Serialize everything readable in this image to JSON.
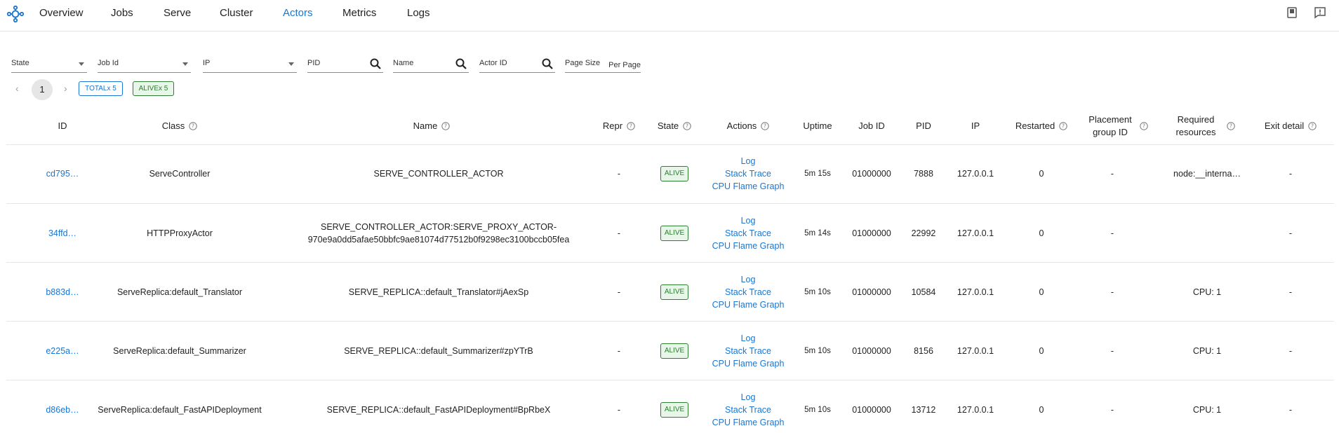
{
  "nav": {
    "items": [
      {
        "label": "Overview",
        "active": false
      },
      {
        "label": "Jobs",
        "active": false
      },
      {
        "label": "Serve",
        "active": false
      },
      {
        "label": "Cluster",
        "active": false
      },
      {
        "label": "Actors",
        "active": true
      },
      {
        "label": "Metrics",
        "active": false
      },
      {
        "label": "Logs",
        "active": false
      }
    ],
    "accent_color": "#1976d2"
  },
  "filters": {
    "state_label": "State",
    "job_id_label": "Job Id",
    "ip_label": "IP",
    "pid_label": "PID",
    "name_label": "Name",
    "actor_id_label": "Actor ID",
    "page_size_label": "Page Size",
    "page_size_value": "Per Page"
  },
  "pagination": {
    "current_page": "1",
    "total_chip": "TOTALx 5",
    "alive_chip": "ALIVEx 5"
  },
  "table": {
    "headers": {
      "id": "ID",
      "class": "Class",
      "name": "Name",
      "repr": "Repr",
      "state": "State",
      "actions": "Actions",
      "uptime": "Uptime",
      "job_id": "Job ID",
      "pid": "PID",
      "ip": "IP",
      "restarted": "Restarted",
      "placement_group_id": "Placement group ID",
      "required_resources": "Required resources",
      "exit_detail": "Exit detail"
    },
    "rows": [
      {
        "id": "cd795…",
        "class": "ServeController",
        "name": "SERVE_CONTROLLER_ACTOR",
        "repr": "-",
        "state": "ALIVE",
        "action_log": "Log",
        "action_stack": "Stack Trace",
        "action_flame": "CPU Flame Graph",
        "uptime": "5m 15s",
        "job_id": "01000000",
        "pid": "7888",
        "ip": "127.0.0.1",
        "restarted": "0",
        "placement_group_id": "-",
        "required_resources": "node:__interna…",
        "exit_detail": "-"
      },
      {
        "id": "34ffd…",
        "class": "HTTPProxyActor",
        "name": "SERVE_CONTROLLER_ACTOR:SERVE_PROXY_ACTOR-970e9a0dd5afae50bbfc9ae81074d77512b0f9298ec3100bccb05fea",
        "repr": "-",
        "state": "ALIVE",
        "action_log": "Log",
        "action_stack": "Stack Trace",
        "action_flame": "CPU Flame Graph",
        "uptime": "5m 14s",
        "job_id": "01000000",
        "pid": "22992",
        "ip": "127.0.0.1",
        "restarted": "0",
        "placement_group_id": "-",
        "required_resources": "",
        "exit_detail": "-"
      },
      {
        "id": "b883d…",
        "class": "ServeReplica:default_Translator",
        "name": "SERVE_REPLICA::default_Translator#jAexSp",
        "repr": "-",
        "state": "ALIVE",
        "action_log": "Log",
        "action_stack": "Stack Trace",
        "action_flame": "CPU Flame Graph",
        "uptime": "5m 10s",
        "job_id": "01000000",
        "pid": "10584",
        "ip": "127.0.0.1",
        "restarted": "0",
        "placement_group_id": "-",
        "required_resources": "CPU: 1",
        "exit_detail": "-"
      },
      {
        "id": "e225a…",
        "class": "ServeReplica:default_Summarizer",
        "name": "SERVE_REPLICA::default_Summarizer#zpYTrB",
        "repr": "-",
        "state": "ALIVE",
        "action_log": "Log",
        "action_stack": "Stack Trace",
        "action_flame": "CPU Flame Graph",
        "uptime": "5m 10s",
        "job_id": "01000000",
        "pid": "8156",
        "ip": "127.0.0.1",
        "restarted": "0",
        "placement_group_id": "-",
        "required_resources": "CPU: 1",
        "exit_detail": "-"
      },
      {
        "id": "d86eb…",
        "class": "ServeReplica:default_FastAPIDeployment",
        "name": "SERVE_REPLICA::default_FastAPIDeployment#BpRbeX",
        "repr": "-",
        "state": "ALIVE",
        "action_log": "Log",
        "action_stack": "Stack Trace",
        "action_flame": "CPU Flame Graph",
        "uptime": "5m 10s",
        "job_id": "01000000",
        "pid": "13712",
        "ip": "127.0.0.1",
        "restarted": "0",
        "placement_group_id": "-",
        "required_resources": "CPU: 1",
        "exit_detail": "-"
      }
    ]
  },
  "colors": {
    "link": "#1976d2",
    "alive_green": "#2e7d32",
    "alive_bg": "#e8f5e9"
  },
  "icons": {
    "logo": "ray-logo-icon",
    "docs": "book-icon",
    "feedback": "feedback-icon",
    "search": "search-icon",
    "help": "help-circle-icon"
  }
}
